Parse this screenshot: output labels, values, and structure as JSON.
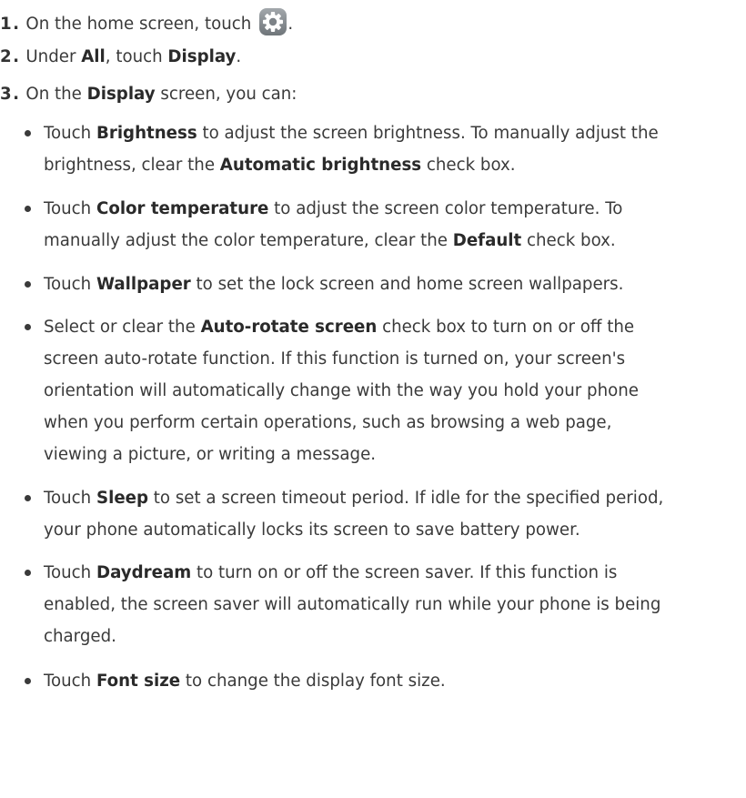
{
  "steps": [
    {
      "num": "1.",
      "parts": [
        "On the home screen, touch",
        "."
      ]
    },
    {
      "num": "2.",
      "parts": [
        "Under ",
        "All",
        ", touch ",
        "Display",
        "."
      ]
    },
    {
      "num": "3.",
      "parts": [
        "On the ",
        "Display",
        " screen, you can:"
      ]
    }
  ],
  "bullets": [
    {
      "lines": [
        [
          "Touch ",
          "Brightness",
          " to adjust the screen brightness. To manually adjust the"
        ],
        [
          "brightness, clear the ",
          "Automatic brightness",
          " check box."
        ]
      ]
    },
    {
      "lines": [
        [
          "Touch ",
          "Color temperature",
          " to adjust the screen color temperature. To"
        ],
        [
          "manually adjust the color temperature, clear the ",
          "Default",
          " check box."
        ]
      ]
    },
    {
      "lines": [
        [
          "Touch ",
          "Wallpaper",
          " to set the lock screen and home screen wallpapers."
        ]
      ]
    },
    {
      "lines": [
        [
          "Select or clear the ",
          "Auto-rotate screen",
          " check box to turn on or off the"
        ],
        [
          "screen auto-rotate function. If this function is turned on, your screen's"
        ],
        [
          "orientation will automatically change with the way you hold your phone"
        ],
        [
          "when you perform certain operations, such as browsing a web page,"
        ],
        [
          "viewing a picture, or writing a message."
        ]
      ]
    },
    {
      "lines": [
        [
          "Touch ",
          "Sleep",
          " to set a screen timeout period. If idle for the specified period,"
        ],
        [
          "your phone automatically locks its screen to save battery power."
        ]
      ]
    },
    {
      "lines": [
        [
          "Touch ",
          "Daydream",
          " to turn on or off the screen saver. If this function is"
        ],
        [
          "enabled, the screen saver will automatically run while your phone is being"
        ],
        [
          "charged."
        ]
      ]
    },
    {
      "lines": [
        [
          "Touch ",
          "Font size",
          " to change the display font size."
        ]
      ]
    }
  ],
  "icons": {
    "settings": "gear-icon"
  },
  "colors": {
    "text": "#3a3a3a",
    "icon_bg": "#8a8f93"
  }
}
